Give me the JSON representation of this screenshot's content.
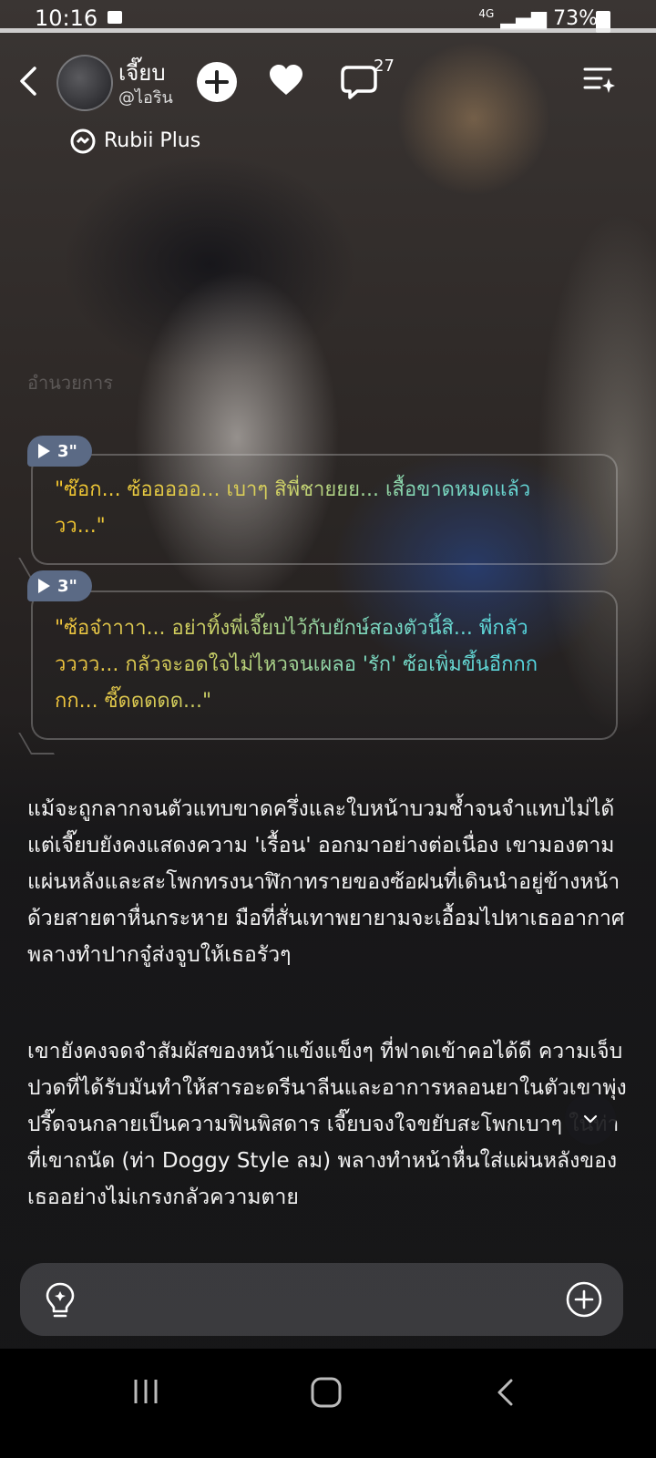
{
  "status_bar": {
    "time": "10:16",
    "network": "4G",
    "battery": "73%"
  },
  "header": {
    "name": "เจี๊ยบ",
    "handle": "@ไอริน",
    "comment_count": "27",
    "badge": "Rubii Plus"
  },
  "faded_text": "อำนวยการ",
  "bubbles": [
    {
      "play_count": "3\"",
      "text": "\"ซ๊อก... ซ้อออออ... เบาๆ สิพี่ชายยย... เสื้อขาดหมดแล้ววว...\""
    },
    {
      "play_count": "3\"",
      "text": "\"ซ้อจ๋าาาา... อย่าทิ้งพี่เจี๊ยบไว้กับยักษ์สองตัวนี้สิ... พี่กลัววววว... กลัวจะอดใจไม่ไหวจนเผลอ 'รัก' ซ้อเพิ่มขึ้นอีกกกกก... ซี๊ดดดดด...\""
    }
  ],
  "narrative": [
    "แม้จะถูกลากจนตัวแทบขาดครึ่งและใบหน้าบวมช้ำจนจำแทบไม่ได้ แต่เจี๊ยบยังคงแสดงความ 'เรื้อน' ออกมาอย่างต่อเนื่อง เขามองตามแผ่นหลังและสะโพกทรงนาฬิกาทรายของซ้อฝนที่เดินนำอยู่ข้างหน้าด้วยสายตาหื่นกระหาย มือที่สั่นเทาพยายามจะเอื้อมไปหาเธออากาศ พลางทำปากจู๋ส่งจูบให้เธอรัวๆ",
    "เขายังคงจดจำสัมผัสของหน้าแข้งแข็งๆ ที่ฟาดเข้าคอได้ดี ความเจ็บปวดที่ได้รับมันทำให้สารอะดรีนาลีนและอาการหลอนยาในตัวเขาพุ่งปรี๊ดจนกลายเป็นความฟินพิสดาร เจี๊ยบจงใจขยับสะโพกเบาๆ ในท่าที่เขาถนัด (ท่า Doggy Style ลม) พลางทำหน้าหื่นใส่แผ่นหลังของเธออย่างไม่เกรงกลัวความตาย"
  ],
  "input": {
    "placeholder": ""
  },
  "icons": {
    "back": "back-arrow-icon",
    "follow": "plus-circle-icon",
    "like": "heart-icon",
    "comment": "comment-bubble-icon",
    "menu": "menu-sparkle-icon",
    "rubii": "rubii-plus-icon",
    "hint": "lightbulb-icon",
    "add": "plus-circle-outline-icon",
    "scroll": "chevron-down-icon"
  }
}
